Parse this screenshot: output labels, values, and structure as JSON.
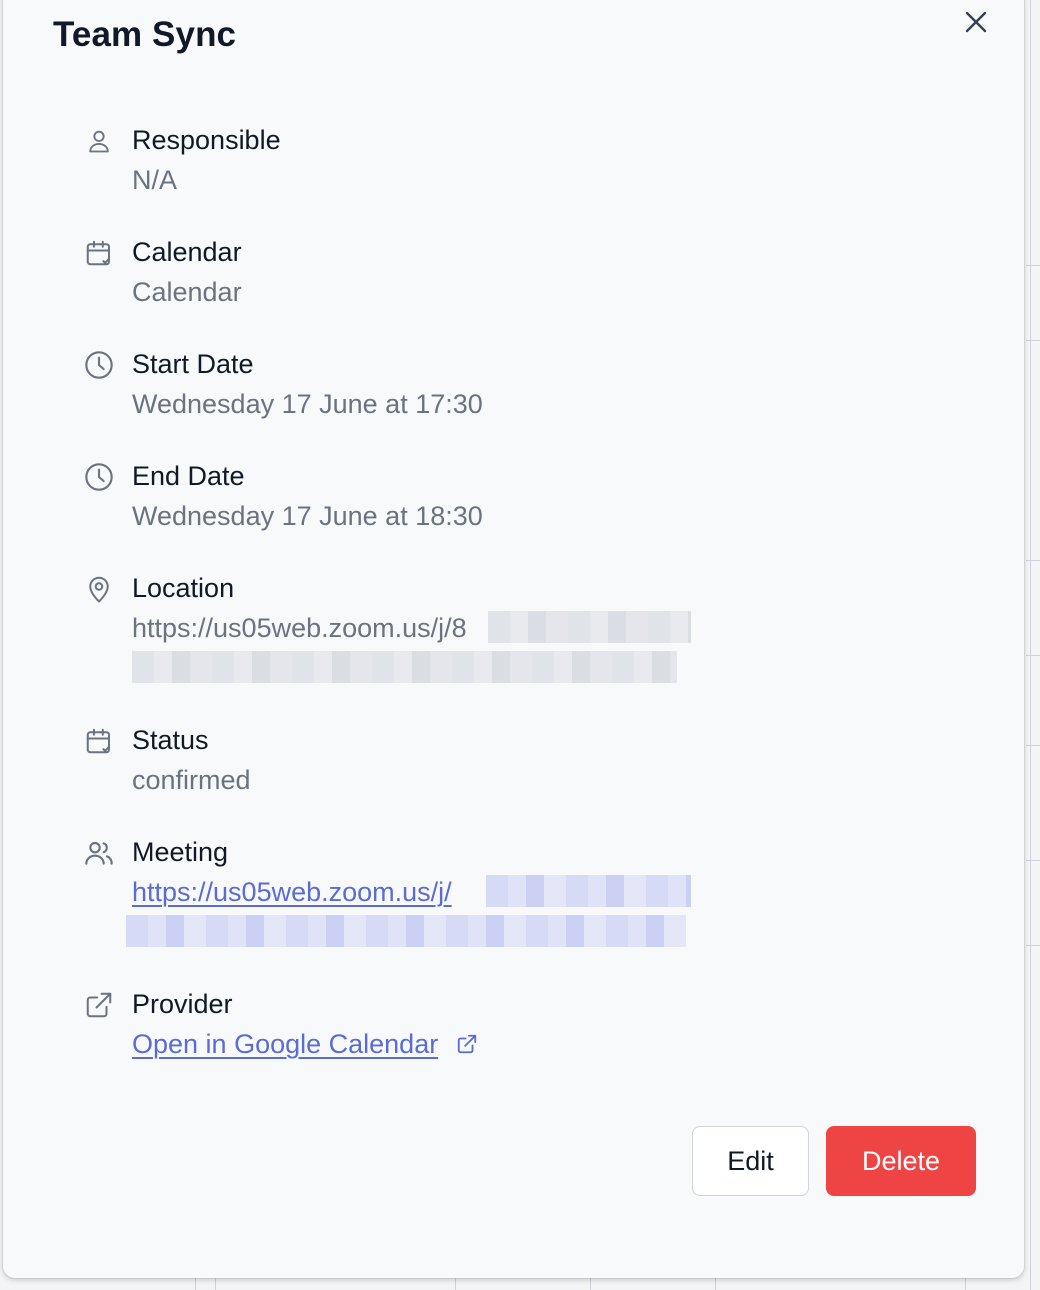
{
  "modal": {
    "title": "Team Sync",
    "fields": {
      "responsible": {
        "label": "Responsible",
        "value": "N/A"
      },
      "calendar": {
        "label": "Calendar",
        "value": "Calendar"
      },
      "start_date": {
        "label": "Start Date",
        "value": "Wednesday 17 June at 17:30"
      },
      "end_date": {
        "label": "End Date",
        "value": "Wednesday 17 June at 18:30"
      },
      "location": {
        "label": "Location",
        "value": "https://us05web.zoom.us/j/8"
      },
      "status": {
        "label": "Status",
        "value": "confirmed"
      },
      "meeting": {
        "label": "Meeting",
        "value": "https://us05web.zoom.us/j/"
      },
      "provider": {
        "label": "Provider",
        "value": "Open in Google Calendar"
      }
    },
    "actions": {
      "edit_label": "Edit",
      "delete_label": "Delete"
    }
  },
  "icons": {
    "close": "close-icon",
    "responsible": "user-icon",
    "calendar": "calendar-check-icon",
    "start_date": "clock-icon",
    "end_date": "clock-icon",
    "location": "map-pin-icon",
    "status": "calendar-check-icon",
    "meeting": "users-icon",
    "provider": "external-link-icon"
  },
  "colors": {
    "delete_button": "#ef4444",
    "link": "#5a6bd6",
    "muted_text": "#6b7280",
    "modal_background": "#f8f9fb"
  }
}
